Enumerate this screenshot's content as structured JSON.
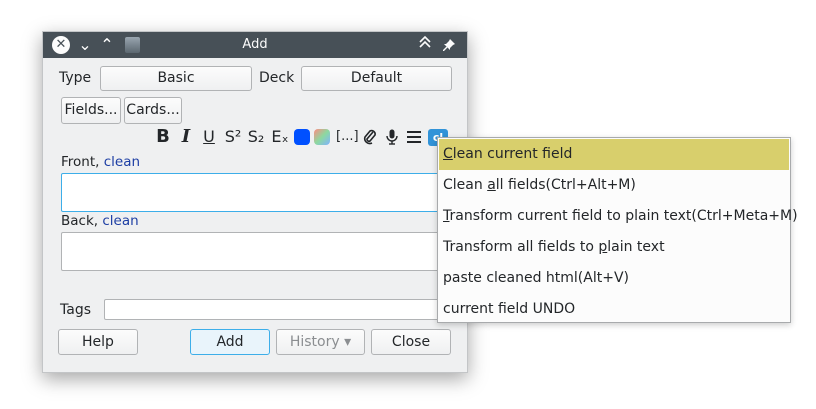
{
  "window": {
    "title": "Add",
    "close_glyph": "✕",
    "minimize_glyph": "⌄",
    "maximize_glyph": "⌃",
    "keep_above_glyph": "⌃",
    "pin_glyph": "✦"
  },
  "top_row": {
    "type_label": "Type",
    "type_value": "Basic",
    "deck_label": "Deck",
    "deck_value": "Default"
  },
  "buttons_row": {
    "fields_label": "Fields...",
    "cards_label": "Cards..."
  },
  "format_toolbar": {
    "bold": "B",
    "italic": "I",
    "underline": "U",
    "superscript": "S²",
    "subscript": "S₂",
    "clear_format": "Eₓ",
    "cloze": "[...]",
    "attach": "🖇",
    "record": "🎙",
    "more": "≡",
    "text_color": "#0050ff",
    "highlight_colors": [
      "#ff8a80",
      "#8cd9a0",
      "#80b3ff"
    ],
    "cleaner_icon_label": "cl"
  },
  "fields": [
    {
      "name": "Front",
      "sep": ", ",
      "action": "clean"
    },
    {
      "name": "Back",
      "sep": ", ",
      "action": "clean"
    }
  ],
  "tags_label": "Tags",
  "bottom_buttons": {
    "help": "Help",
    "add": "Add",
    "history": "History ▾",
    "close": "Close"
  },
  "context_menu": {
    "items": [
      {
        "pre": "",
        "mn": "C",
        "post": "lean current field",
        "active": true
      },
      {
        "pre": "Clean ",
        "mn": "a",
        "post": "ll fields(Ctrl+Alt+M)",
        "active": false
      },
      {
        "pre": "",
        "mn": "T",
        "post": "ransform current field to plain text(Ctrl+Meta+M)",
        "active": false
      },
      {
        "pre": "Transform all fields to ",
        "mn": "p",
        "post": "lain text",
        "active": false
      },
      {
        "pre": "paste cleaned html(Alt+V)",
        "mn": "",
        "post": "",
        "active": false
      },
      {
        "pre": "current field UNDO",
        "mn": "",
        "post": "",
        "active": false
      }
    ]
  }
}
